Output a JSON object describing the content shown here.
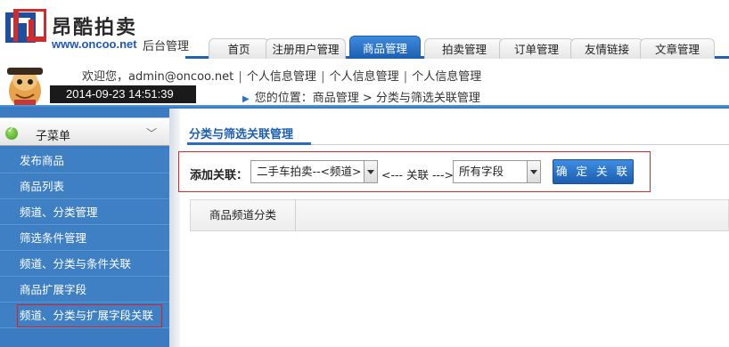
{
  "brand": {
    "name": "昂酷拍卖",
    "url": "www.oncoo.net",
    "backend_label": "后台管理"
  },
  "nav": {
    "tabs": [
      {
        "label": "首页",
        "active": false
      },
      {
        "label": "注册用户管理",
        "active": false
      },
      {
        "label": "商品管理",
        "active": true
      },
      {
        "label": "拍卖管理",
        "active": false
      },
      {
        "label": "订单管理",
        "active": false
      },
      {
        "label": "友情链接",
        "active": false
      },
      {
        "label": "文章管理",
        "active": false
      }
    ]
  },
  "topbar": {
    "welcome": "欢迎您，admin@oncoo.net",
    "links": [
      "个人信息管理",
      "个人信息管理",
      "个人信息管理"
    ],
    "separator": "|",
    "datetime": "2014-09-23 14:51:39",
    "breadcrumb": "您的位置：商品管理 > 分类与筛选关联管理"
  },
  "sidebar": {
    "header": "子菜单",
    "items": [
      {
        "label": "发布商品"
      },
      {
        "label": "商品列表"
      },
      {
        "label": "频道、分类管理"
      },
      {
        "label": "筛选条件管理"
      },
      {
        "label": "频道、分类与条件关联"
      },
      {
        "label": "商品扩展字段"
      },
      {
        "label": "频道、分类与扩展字段关联"
      }
    ]
  },
  "main": {
    "section_tab": "分类与筛选关联管理",
    "form": {
      "label": "添加关联：",
      "select_left_value": "二手车拍卖--<频道>",
      "arrow_text": "<--- 关联 --->",
      "select_right_value": "所有字段",
      "confirm_label": "确 定 关 联"
    },
    "table": {
      "columns": [
        "商品频道分类"
      ]
    }
  },
  "colors": {
    "accent": "#1e63b3",
    "sidebar_bg": "#3f7fc4",
    "highlight_border": "#d62b2b"
  }
}
